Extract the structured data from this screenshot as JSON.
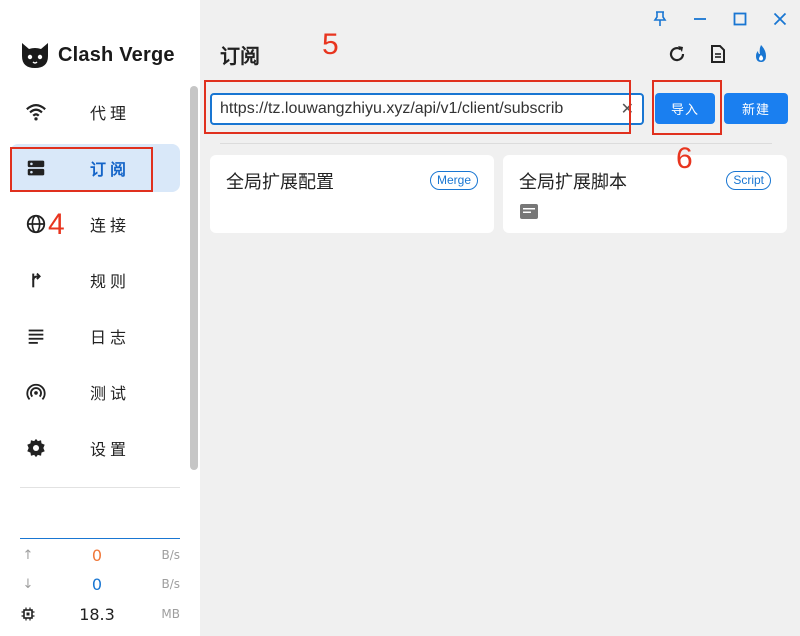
{
  "app": {
    "name": "Clash Verge"
  },
  "sidebar": {
    "items": [
      {
        "label": "代理",
        "icon": "wifi-icon"
      },
      {
        "label": "订阅",
        "icon": "dns-icon",
        "active": true
      },
      {
        "label": "连接",
        "icon": "globe-icon"
      },
      {
        "label": "规则",
        "icon": "fork-icon"
      },
      {
        "label": "日志",
        "icon": "list-icon"
      },
      {
        "label": "测试",
        "icon": "radar-icon"
      },
      {
        "label": "设置",
        "icon": "gear-icon"
      }
    ],
    "traffic": {
      "upload": {
        "value": "0",
        "unit": "B/s",
        "color": "#f0783a"
      },
      "download": {
        "value": "0",
        "unit": "B/s",
        "color": "#1976d2"
      },
      "memory": {
        "value": "18.3",
        "unit": "MB"
      }
    }
  },
  "header": {
    "title": "订阅"
  },
  "profiles": {
    "url_input": "https://tz.louwangzhiyu.xyz/api/v1/client/subscrib",
    "import_button": "导入",
    "new_button": "新建",
    "cards": [
      {
        "title": "全局扩展配置",
        "tag": "Merge"
      },
      {
        "title": "全局扩展脚本",
        "tag": "Script"
      }
    ]
  },
  "annotations": [
    "4",
    "5",
    "6"
  ],
  "colors": {
    "accent": "#1976d2",
    "button": "#1a7ff0",
    "active_bg": "#d9e8f9",
    "annotation": "#e0301e"
  }
}
